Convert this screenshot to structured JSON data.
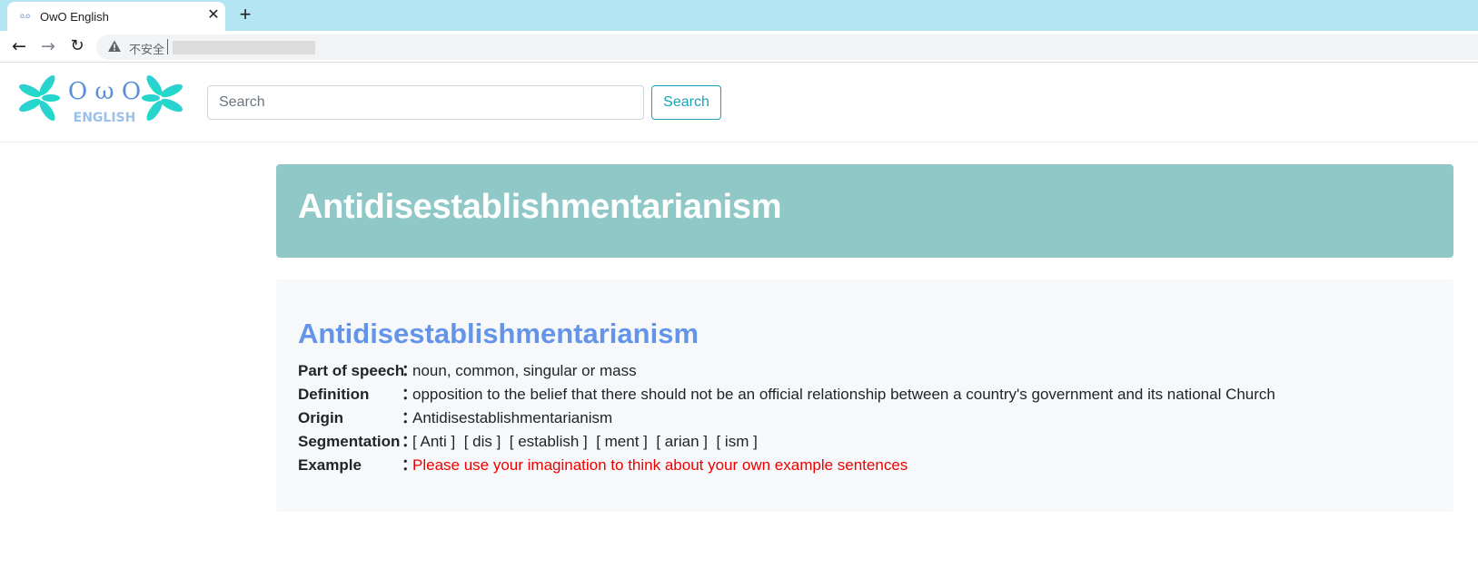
{
  "browser": {
    "tab_title": "OwO English",
    "tab_favicon": "o.o",
    "new_tab": "+",
    "close_tab": "✕",
    "security_label": "不安全"
  },
  "header": {
    "logo_top": "O ω O",
    "logo_bottom": "ENGLISH",
    "search_placeholder": "Search",
    "search_button": "Search"
  },
  "word": {
    "jumbotron_title": "Antidisestablishmentarianism",
    "title": "Antidisestablishmentarianism",
    "colon": "：",
    "rows": [
      {
        "label": "Part of speech",
        "value": "noun, common, singular or mass"
      },
      {
        "label": "Definition",
        "value": "opposition to the belief that there should not be an official relationship between a country's government and its national Church"
      },
      {
        "label": "Origin",
        "value": "Antidisestablishmentarianism"
      },
      {
        "label": "Segmentation",
        "value": "[ Anti ]  [ dis ]  [ establish ]  [ ment ]  [ arian ]  [ ism ]"
      },
      {
        "label": "Example",
        "value": "Please use your imagination to think about your own example sentences"
      }
    ]
  },
  "colors": {
    "tabstrip": "#b3e6f2",
    "jumbotron": "#90c8c7",
    "word_title": "#6494e8",
    "search_button": "#17a2b8",
    "example_text": "#ee0000"
  }
}
